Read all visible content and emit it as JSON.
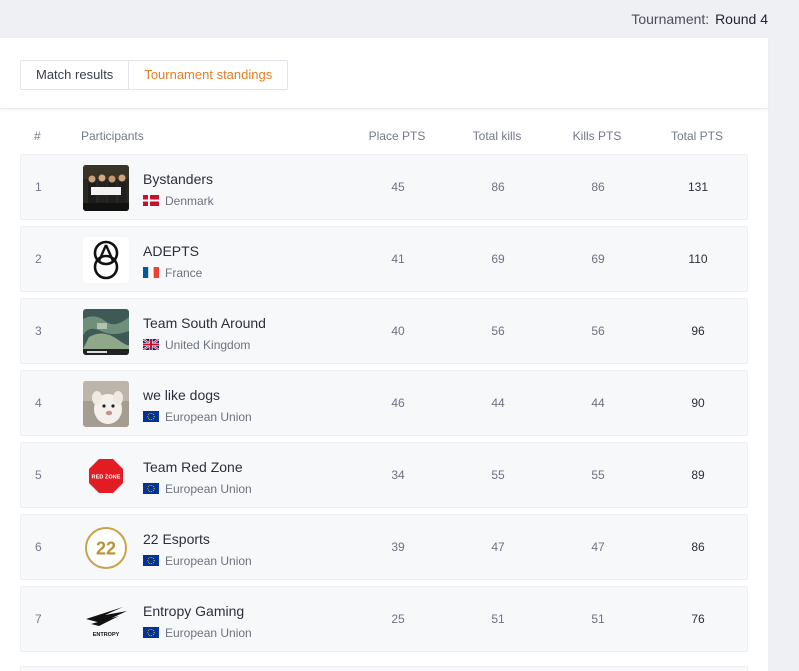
{
  "header": {
    "tournament_label": "Tournament:",
    "tournament_value": "Round 4"
  },
  "tabs": [
    {
      "label": "Match results",
      "active": false
    },
    {
      "label": "Tournament standings",
      "active": true
    }
  ],
  "columns": {
    "rank": "#",
    "participants": "Participants",
    "place_pts": "Place PTS",
    "total_kills": "Total kills",
    "kills_pts": "Kills PTS",
    "total_pts": "Total PTS"
  },
  "colors": {
    "accent": "#e67e22",
    "row_bg": "#f7f8fa",
    "page_bg": "#eef0f4"
  },
  "standings": [
    {
      "rank": "1",
      "name": "Bystanders",
      "country": "Denmark",
      "flag": "denmark-flag",
      "logo": "team-photo-logo",
      "place_pts": "45",
      "total_kills": "86",
      "kills_pts": "86",
      "total_pts": "131"
    },
    {
      "rank": "2",
      "name": "ADEPTS",
      "country": "France",
      "flag": "france-flag",
      "logo": "adepts-circles-logo",
      "place_pts": "41",
      "total_kills": "69",
      "kills_pts": "69",
      "total_pts": "110"
    },
    {
      "rank": "3",
      "name": "Team South Around",
      "country": "United Kingdom",
      "flag": "uk-flag",
      "logo": "map-screenshot-logo",
      "place_pts": "40",
      "total_kills": "56",
      "kills_pts": "56",
      "total_pts": "96"
    },
    {
      "rank": "4",
      "name": "we like dogs",
      "country": "European Union",
      "flag": "eu-flag",
      "logo": "dog-logo",
      "place_pts": "46",
      "total_kills": "44",
      "kills_pts": "44",
      "total_pts": "90"
    },
    {
      "rank": "5",
      "name": "Team Red Zone",
      "country": "European Union",
      "flag": "eu-flag",
      "logo": "red-zone-stop-sign-logo",
      "logo_text": "RED ZONE",
      "place_pts": "34",
      "total_kills": "55",
      "kills_pts": "55",
      "total_pts": "89"
    },
    {
      "rank": "6",
      "name": "22 Esports",
      "country": "European Union",
      "flag": "eu-flag",
      "logo": "22-gold-circle-logo",
      "logo_text": "22",
      "place_pts": "39",
      "total_kills": "47",
      "kills_pts": "47",
      "total_pts": "86"
    },
    {
      "rank": "7",
      "name": "Entropy Gaming",
      "country": "European Union",
      "flag": "eu-flag",
      "logo": "entropy-wing-logo",
      "logo_text": "ENTROPY",
      "place_pts": "25",
      "total_kills": "51",
      "kills_pts": "51",
      "total_pts": "76"
    }
  ]
}
